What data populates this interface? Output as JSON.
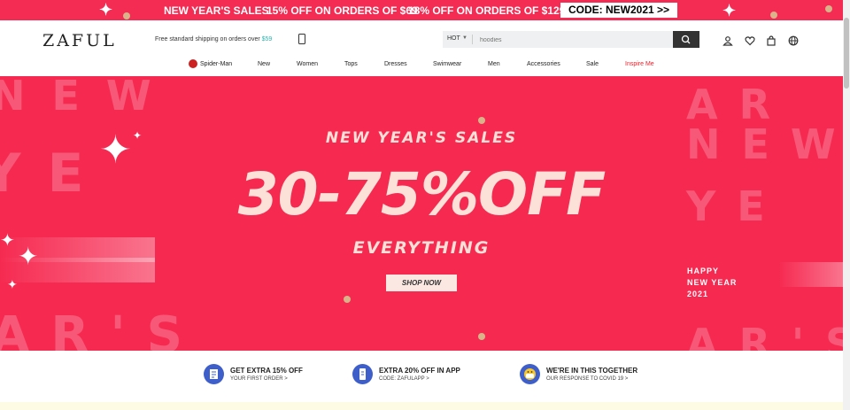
{
  "topbar": {
    "sale": "NEW YEAR'S SALES",
    "offer1": "15% OFF ON ORDERS OF $69",
    "offer2": "18% OFF ON ORDERS OF $129",
    "code": "CODE: NEW2021 >>",
    "bg_color": "#f42b52"
  },
  "header": {
    "logo": "ZAFUL",
    "shipping_text": "Free standard shipping on orders over ",
    "shipping_amount": "$59",
    "search": {
      "category": "HOT",
      "placeholder": "hoodies"
    }
  },
  "nav": {
    "items": [
      "Spider-Man",
      "New",
      "Women",
      "Tops",
      "Dresses",
      "Swimwear",
      "Men",
      "Accessories",
      "Sale",
      "Inspire Me"
    ]
  },
  "hero": {
    "headline": "NEW YEAR'S SALES",
    "discount": "30-75%OFF",
    "subline": "EVERYTHING",
    "cta": "SHOP NOW",
    "greeting": [
      "HAPPY",
      "NEW YEAR",
      "2021"
    ],
    "bg_color": "#f62a51"
  },
  "promos": [
    {
      "title": "GET EXTRA 15% OFF",
      "sub": "YOUR FIRST ORDER >"
    },
    {
      "title": "EXTRA 20% OFF IN APP",
      "sub": "CODE: ZAFULAPP >"
    },
    {
      "title": "WE'RE IN THIS TOGETHER",
      "sub": "OUR RESPONSE TO COVID 19 >"
    }
  ]
}
